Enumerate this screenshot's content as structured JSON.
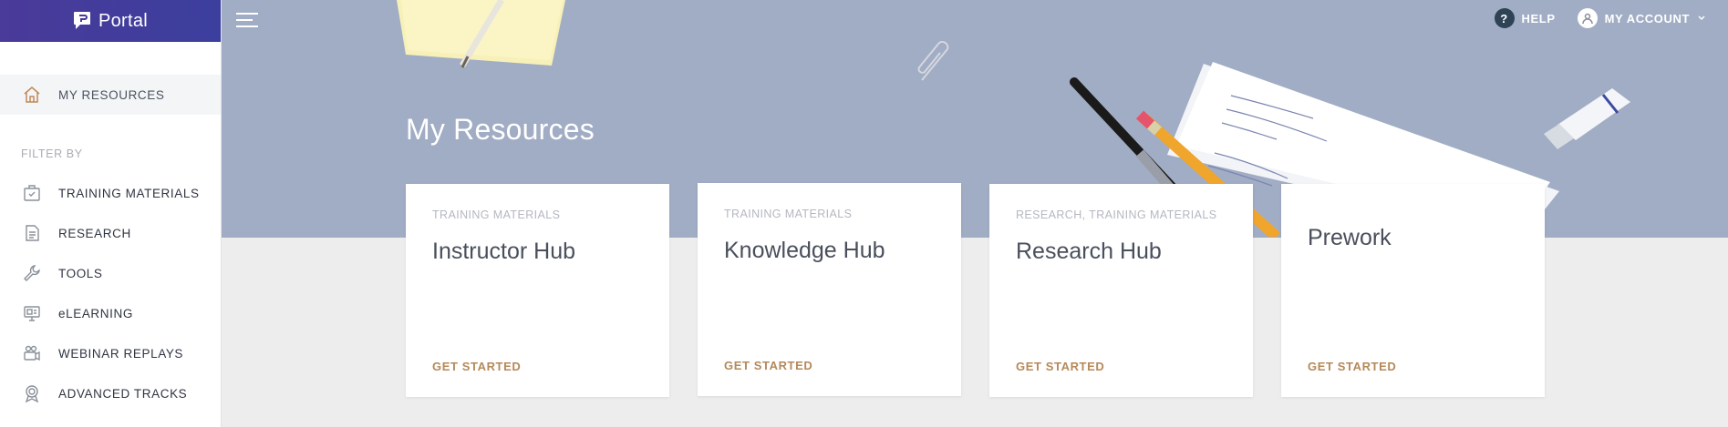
{
  "brand": {
    "name": "Portal"
  },
  "sidebar": {
    "active_item": {
      "label": "MY RESOURCES",
      "icon": "home-icon"
    },
    "filter_label": "FILTER BY",
    "items": [
      {
        "label": "TRAINING MATERIALS",
        "icon": "training-materials-icon"
      },
      {
        "label": "RESEARCH",
        "icon": "document-icon"
      },
      {
        "label": "TOOLS",
        "icon": "wrench-icon"
      },
      {
        "label": "eLEARNING",
        "icon": "monitor-icon"
      },
      {
        "label": "WEBINAR REPLAYS",
        "icon": "video-camera-icon"
      },
      {
        "label": "ADVANCED TRACKS",
        "icon": "badge-icon"
      }
    ]
  },
  "header": {
    "help_label": "HELP",
    "account_label": "MY ACCOUNT"
  },
  "main": {
    "title": "My Resources",
    "cards": [
      {
        "category": "TRAINING MATERIALS",
        "title": "Instructor Hub",
        "cta": "GET STARTED"
      },
      {
        "category": "TRAINING MATERIALS",
        "title": "Knowledge Hub",
        "cta": "GET STARTED"
      },
      {
        "category": "RESEARCH, TRAINING MATERIALS",
        "title": "Research Hub",
        "cta": "GET STARTED"
      },
      {
        "category": "",
        "title": "Prework",
        "cta": "GET STARTED"
      }
    ]
  },
  "colors": {
    "brand_gradient_start": "#4a3a99",
    "brand_gradient_end": "#3c3f9e",
    "hero_background": "#a1adc4",
    "page_background": "#ededee",
    "cta": "#b5895a",
    "help_badge": "#2f4356"
  }
}
